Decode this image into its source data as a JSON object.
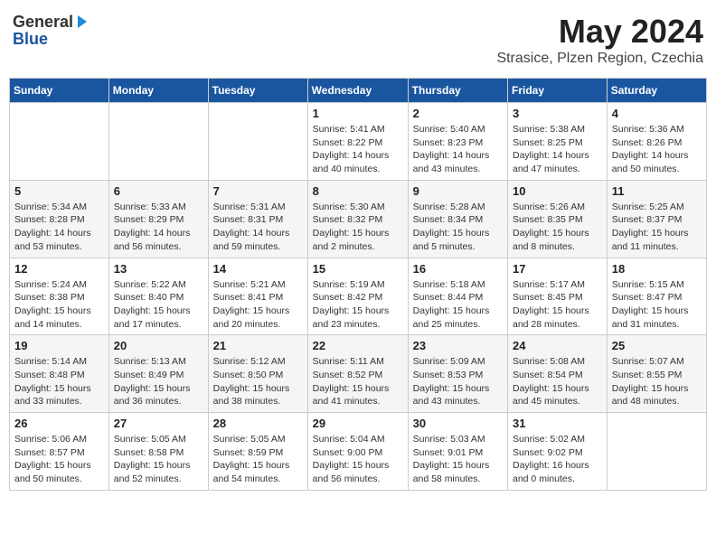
{
  "header": {
    "logo_general": "General",
    "logo_blue": "Blue",
    "month_title": "May 2024",
    "location": "Strasice, Plzen Region, Czechia"
  },
  "weekdays": [
    "Sunday",
    "Monday",
    "Tuesday",
    "Wednesday",
    "Thursday",
    "Friday",
    "Saturday"
  ],
  "weeks": [
    [
      {
        "day": "",
        "info": ""
      },
      {
        "day": "",
        "info": ""
      },
      {
        "day": "",
        "info": ""
      },
      {
        "day": "1",
        "info": "Sunrise: 5:41 AM\nSunset: 8:22 PM\nDaylight: 14 hours\nand 40 minutes."
      },
      {
        "day": "2",
        "info": "Sunrise: 5:40 AM\nSunset: 8:23 PM\nDaylight: 14 hours\nand 43 minutes."
      },
      {
        "day": "3",
        "info": "Sunrise: 5:38 AM\nSunset: 8:25 PM\nDaylight: 14 hours\nand 47 minutes."
      },
      {
        "day": "4",
        "info": "Sunrise: 5:36 AM\nSunset: 8:26 PM\nDaylight: 14 hours\nand 50 minutes."
      }
    ],
    [
      {
        "day": "5",
        "info": "Sunrise: 5:34 AM\nSunset: 8:28 PM\nDaylight: 14 hours\nand 53 minutes."
      },
      {
        "day": "6",
        "info": "Sunrise: 5:33 AM\nSunset: 8:29 PM\nDaylight: 14 hours\nand 56 minutes."
      },
      {
        "day": "7",
        "info": "Sunrise: 5:31 AM\nSunset: 8:31 PM\nDaylight: 14 hours\nand 59 minutes."
      },
      {
        "day": "8",
        "info": "Sunrise: 5:30 AM\nSunset: 8:32 PM\nDaylight: 15 hours\nand 2 minutes."
      },
      {
        "day": "9",
        "info": "Sunrise: 5:28 AM\nSunset: 8:34 PM\nDaylight: 15 hours\nand 5 minutes."
      },
      {
        "day": "10",
        "info": "Sunrise: 5:26 AM\nSunset: 8:35 PM\nDaylight: 15 hours\nand 8 minutes."
      },
      {
        "day": "11",
        "info": "Sunrise: 5:25 AM\nSunset: 8:37 PM\nDaylight: 15 hours\nand 11 minutes."
      }
    ],
    [
      {
        "day": "12",
        "info": "Sunrise: 5:24 AM\nSunset: 8:38 PM\nDaylight: 15 hours\nand 14 minutes."
      },
      {
        "day": "13",
        "info": "Sunrise: 5:22 AM\nSunset: 8:40 PM\nDaylight: 15 hours\nand 17 minutes."
      },
      {
        "day": "14",
        "info": "Sunrise: 5:21 AM\nSunset: 8:41 PM\nDaylight: 15 hours\nand 20 minutes."
      },
      {
        "day": "15",
        "info": "Sunrise: 5:19 AM\nSunset: 8:42 PM\nDaylight: 15 hours\nand 23 minutes."
      },
      {
        "day": "16",
        "info": "Sunrise: 5:18 AM\nSunset: 8:44 PM\nDaylight: 15 hours\nand 25 minutes."
      },
      {
        "day": "17",
        "info": "Sunrise: 5:17 AM\nSunset: 8:45 PM\nDaylight: 15 hours\nand 28 minutes."
      },
      {
        "day": "18",
        "info": "Sunrise: 5:15 AM\nSunset: 8:47 PM\nDaylight: 15 hours\nand 31 minutes."
      }
    ],
    [
      {
        "day": "19",
        "info": "Sunrise: 5:14 AM\nSunset: 8:48 PM\nDaylight: 15 hours\nand 33 minutes."
      },
      {
        "day": "20",
        "info": "Sunrise: 5:13 AM\nSunset: 8:49 PM\nDaylight: 15 hours\nand 36 minutes."
      },
      {
        "day": "21",
        "info": "Sunrise: 5:12 AM\nSunset: 8:50 PM\nDaylight: 15 hours\nand 38 minutes."
      },
      {
        "day": "22",
        "info": "Sunrise: 5:11 AM\nSunset: 8:52 PM\nDaylight: 15 hours\nand 41 minutes."
      },
      {
        "day": "23",
        "info": "Sunrise: 5:09 AM\nSunset: 8:53 PM\nDaylight: 15 hours\nand 43 minutes."
      },
      {
        "day": "24",
        "info": "Sunrise: 5:08 AM\nSunset: 8:54 PM\nDaylight: 15 hours\nand 45 minutes."
      },
      {
        "day": "25",
        "info": "Sunrise: 5:07 AM\nSunset: 8:55 PM\nDaylight: 15 hours\nand 48 minutes."
      }
    ],
    [
      {
        "day": "26",
        "info": "Sunrise: 5:06 AM\nSunset: 8:57 PM\nDaylight: 15 hours\nand 50 minutes."
      },
      {
        "day": "27",
        "info": "Sunrise: 5:05 AM\nSunset: 8:58 PM\nDaylight: 15 hours\nand 52 minutes."
      },
      {
        "day": "28",
        "info": "Sunrise: 5:05 AM\nSunset: 8:59 PM\nDaylight: 15 hours\nand 54 minutes."
      },
      {
        "day": "29",
        "info": "Sunrise: 5:04 AM\nSunset: 9:00 PM\nDaylight: 15 hours\nand 56 minutes."
      },
      {
        "day": "30",
        "info": "Sunrise: 5:03 AM\nSunset: 9:01 PM\nDaylight: 15 hours\nand 58 minutes."
      },
      {
        "day": "31",
        "info": "Sunrise: 5:02 AM\nSunset: 9:02 PM\nDaylight: 16 hours\nand 0 minutes."
      },
      {
        "day": "",
        "info": ""
      }
    ]
  ]
}
